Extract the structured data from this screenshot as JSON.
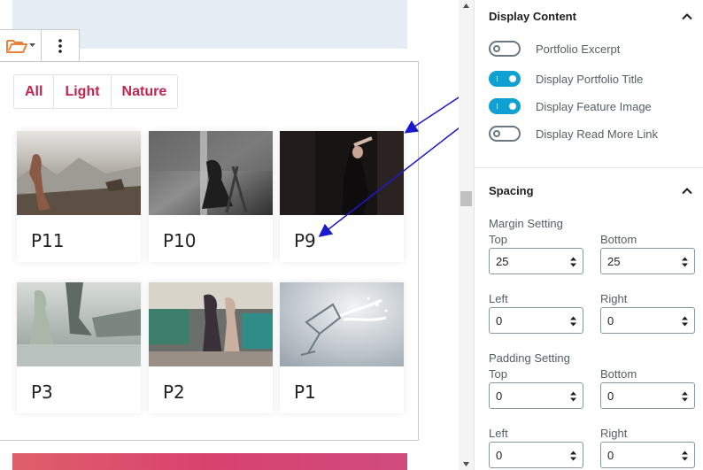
{
  "filters": [
    "All",
    "Light",
    "Nature"
  ],
  "portfolio_items": [
    {
      "title": "P11"
    },
    {
      "title": "P10"
    },
    {
      "title": "P9"
    },
    {
      "title": "P3"
    },
    {
      "title": "P2"
    },
    {
      "title": "P1"
    }
  ],
  "display_content": {
    "heading": "Display Content",
    "toggles": [
      {
        "label": "Portfolio Excerpt",
        "on": false
      },
      {
        "label": "Display Portfolio Title",
        "on": true
      },
      {
        "label": "Display Feature Image",
        "on": true
      },
      {
        "label": "Display Read More Link",
        "on": false
      }
    ]
  },
  "spacing": {
    "heading": "Spacing",
    "margin_label": "Margin Setting",
    "padding_label": "Padding Setting",
    "labels": {
      "top": "Top",
      "bottom": "Bottom",
      "left": "Left",
      "right": "Right"
    },
    "margin": {
      "top": "25",
      "bottom": "25",
      "left": "0",
      "right": "0"
    },
    "padding": {
      "top": "0",
      "bottom": "0",
      "left": "0",
      "right": "0"
    }
  },
  "colors": {
    "accent": "#11a0d2",
    "filter_text": "#c0264f",
    "annotation_arrow": "#1a1acc",
    "folder_icon": "#e8813a"
  },
  "icons": [
    "folder-open-icon",
    "chevron-down-icon",
    "more-vertical-icon",
    "chevron-up-icon",
    "spin-arrows-icon"
  ]
}
